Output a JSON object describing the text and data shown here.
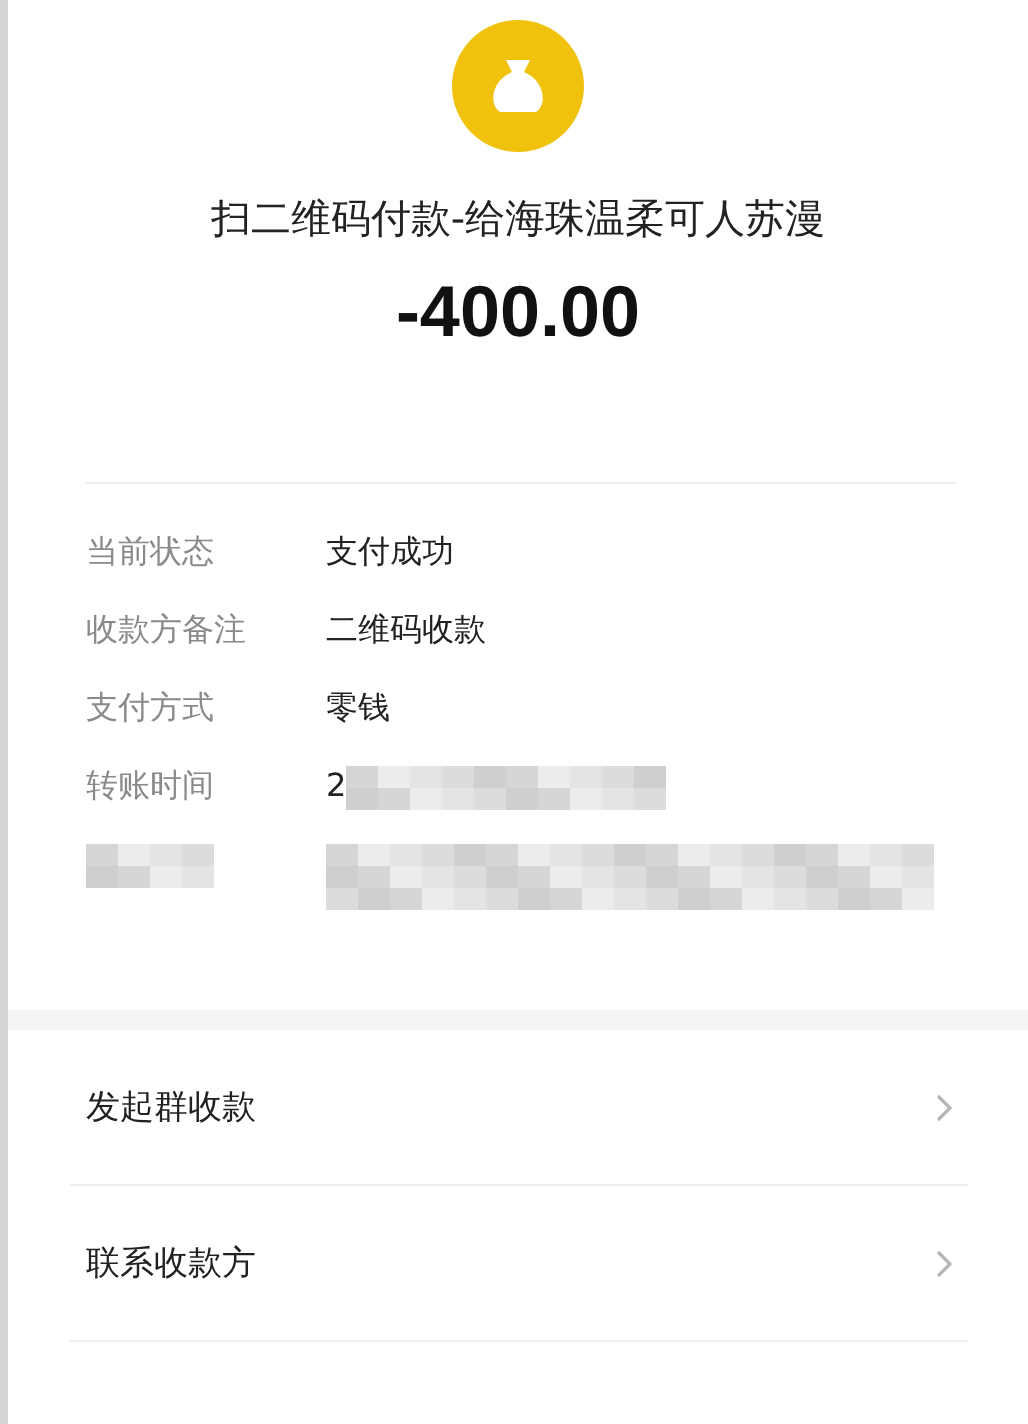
{
  "header": {
    "title": "扫二维码付款-给海珠温柔可人苏漫",
    "amount": "-400.00"
  },
  "details": [
    {
      "kind": "text",
      "label": "当前状态",
      "value": "支付成功"
    },
    {
      "kind": "text",
      "label": "收款方备注",
      "value": "二维码收款"
    },
    {
      "kind": "text",
      "label": "支付方式",
      "value": "零钱"
    },
    {
      "kind": "partly_blurred",
      "label": "转账时间",
      "value": "2"
    },
    {
      "kind": "blurred"
    }
  ],
  "actions": [
    {
      "label": "发起群收款"
    },
    {
      "label": "联系收款方"
    }
  ]
}
